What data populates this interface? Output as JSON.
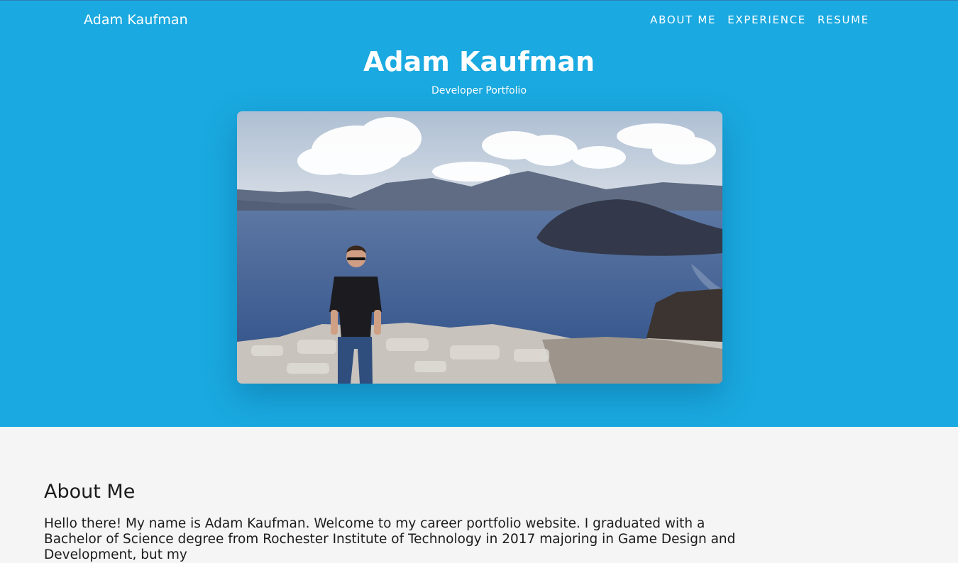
{
  "nav": {
    "brand": "Adam Kaufman",
    "links": [
      {
        "label": "ABOUT ME"
      },
      {
        "label": "EXPERIENCE"
      },
      {
        "label": "RESUME"
      }
    ]
  },
  "hero": {
    "title": "Adam Kaufman",
    "subtitle": "Developer Portfolio",
    "background_color": "#1aa9e0"
  },
  "about": {
    "heading": "About Me",
    "text": "Hello there! My name is Adam Kaufman. Welcome to my career portfolio website. I graduated with a Bachelor of Science degree from Rochester Institute of Technology in 2017 majoring in Game Design and Development, but my"
  }
}
